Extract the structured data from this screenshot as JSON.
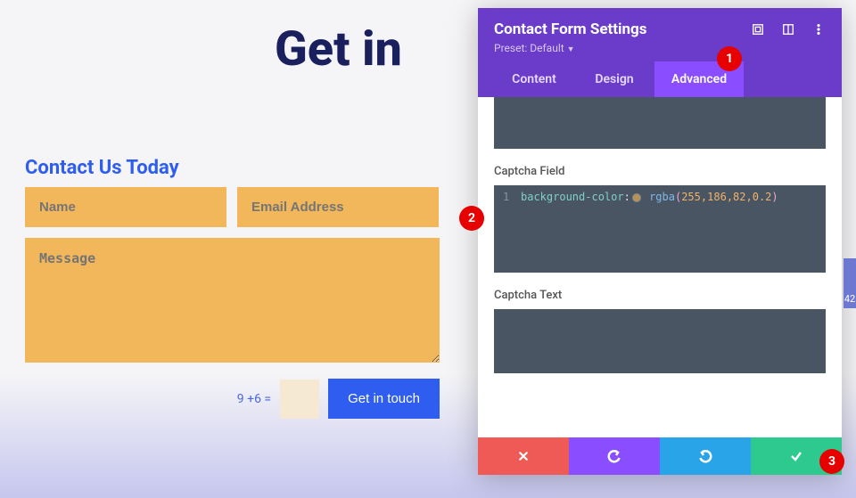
{
  "page": {
    "heading": "Get in",
    "section_title": "Contact Us Today"
  },
  "form": {
    "name_placeholder": "Name",
    "email_placeholder": "Email Address",
    "message_placeholder": "Message",
    "captcha_question": "9 +6 =",
    "submit_label": "Get in touch"
  },
  "panel": {
    "title": "Contact Form Settings",
    "preset_label": "Preset:",
    "preset_value": "Default",
    "tabs": {
      "content": "Content",
      "design": "Design",
      "advanced": "Advanced"
    },
    "fields": {
      "captcha_field_label": "Captcha Field",
      "captcha_text_label": "Captcha Text"
    },
    "code": {
      "line_number": "1",
      "property": "background-color",
      "colon": ":",
      "func": "rgba",
      "open": "(",
      "n1": "255",
      "c1": ",",
      "n2": "186",
      "c2": ",",
      "n3": "82",
      "c3": ",",
      "n4": "0.2",
      "close": ")"
    }
  },
  "pins": {
    "one": "1",
    "two": "2",
    "three": "3"
  },
  "side_marker": "42"
}
